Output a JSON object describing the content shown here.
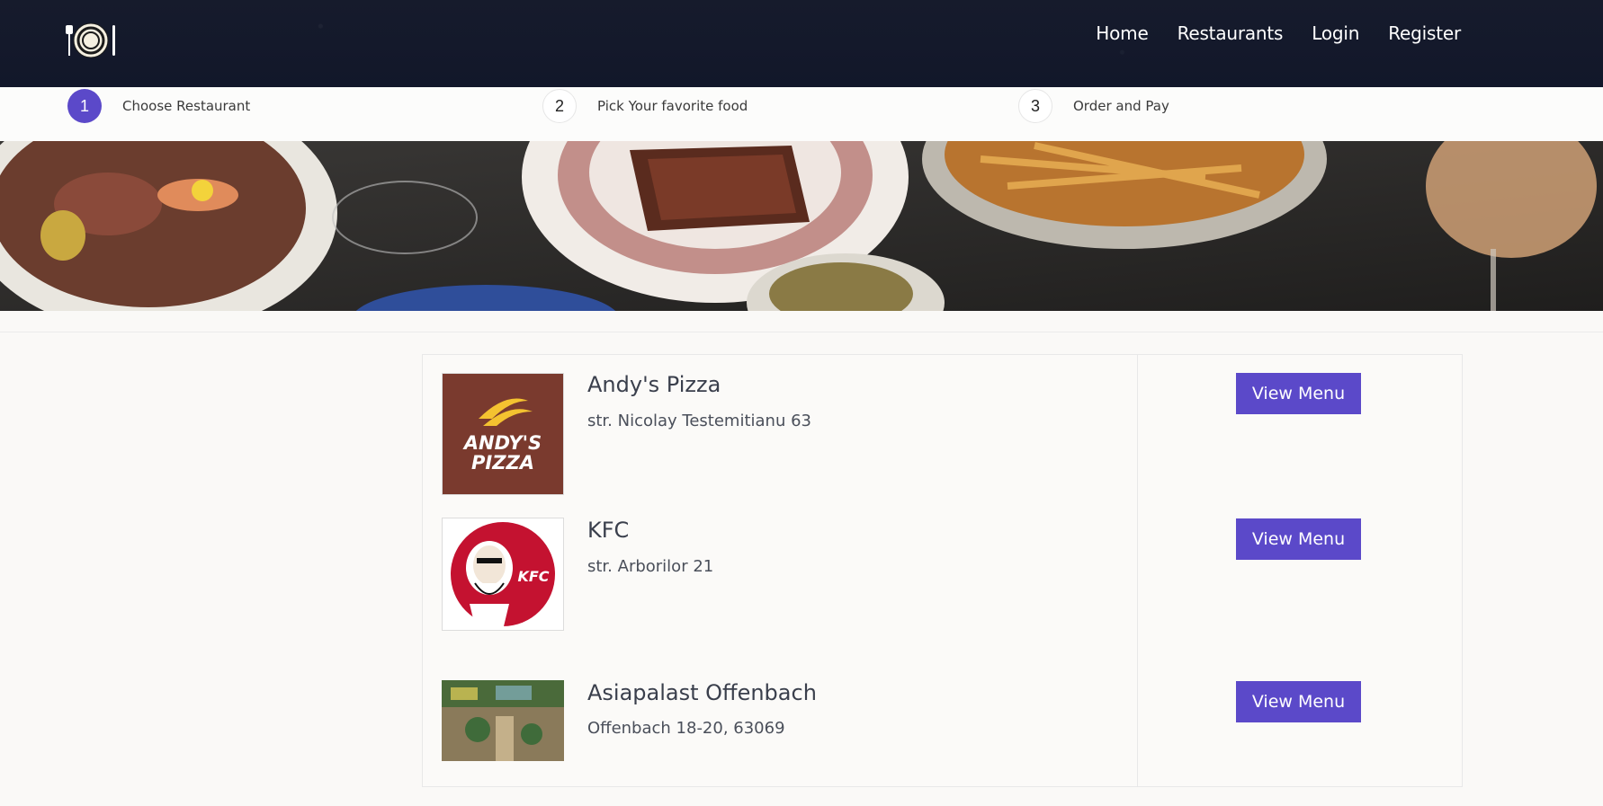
{
  "nav": {
    "home": "Home",
    "restaurants": "Restaurants",
    "login": "Login",
    "register": "Register"
  },
  "steps": [
    {
      "num": "1",
      "label": "Choose Restaurant"
    },
    {
      "num": "2",
      "label": "Pick Your favorite food"
    },
    {
      "num": "3",
      "label": "Order and Pay"
    }
  ],
  "restaurants": [
    {
      "name": "Andy's Pizza",
      "address": "str. Nicolay Testemitianu 63",
      "button": "View Menu",
      "logo_text_1": "ANDY'S",
      "logo_text_2": "PIZZA"
    },
    {
      "name": "KFC",
      "address": "str. Arborilor 21",
      "button": "View Menu",
      "logo_text": "KFC"
    },
    {
      "name": "Asiapalast Offenbach",
      "address": "Offenbach 18-20, 63069",
      "button": "View Menu"
    }
  ],
  "colors": {
    "accent": "#5b49c9",
    "header_bg": "#151a2a",
    "page_bg": "#faf9f7"
  },
  "icons": {
    "logo": "plate-cutlery-icon"
  }
}
